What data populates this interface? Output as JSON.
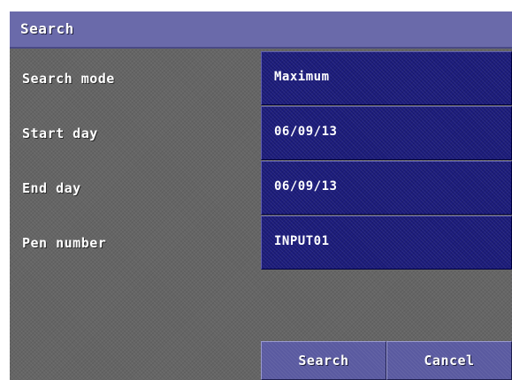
{
  "dialog": {
    "title": "Search"
  },
  "fields": [
    {
      "label": "Search mode",
      "value": "Maximum"
    },
    {
      "label": "Start day",
      "value": "06/09/13"
    },
    {
      "label": "End day",
      "value": "06/09/13"
    },
    {
      "label": "Pen number",
      "value": "INPUT01"
    }
  ],
  "buttons": {
    "search_label": "Search",
    "cancel_label": "Cancel"
  },
  "colors": {
    "titlebar": "#6a6aaa",
    "field": "#1c1c7c",
    "panel": "#656565",
    "button": "#5a5aa0"
  }
}
